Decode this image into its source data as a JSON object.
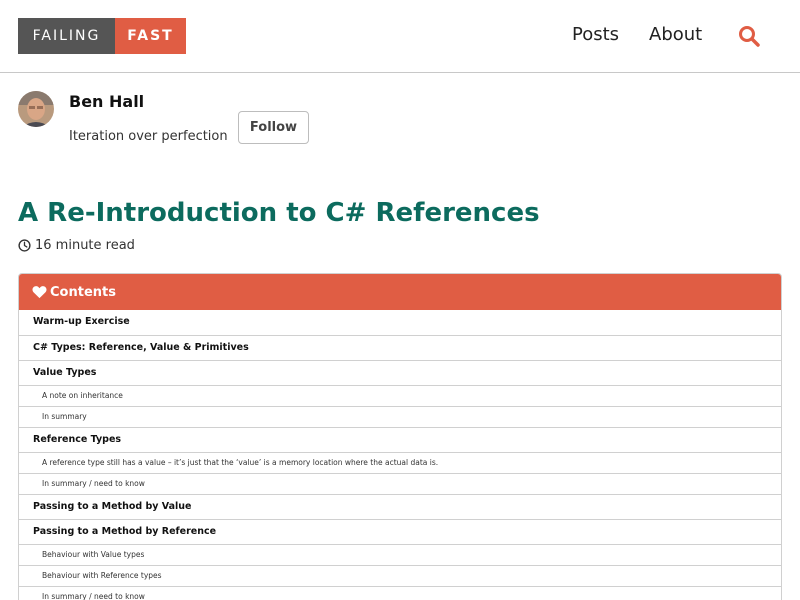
{
  "header": {
    "logo_left": "FAILING",
    "logo_right": "FAST",
    "nav": [
      "Posts",
      "About"
    ],
    "accent": "#e05d44"
  },
  "author": {
    "name": "Ben Hall",
    "bio": "Iteration over perfection",
    "follow_label": "Follow"
  },
  "post": {
    "title": "A Re-Introduction to C# References",
    "read_time": "16 minute read",
    "title_color": "#0c6b5e"
  },
  "toc": {
    "heading": "Contents",
    "items": [
      {
        "label": "Warm-up Exercise",
        "level": 1
      },
      {
        "label": "C# Types: Reference, Value & Primitives",
        "level": 1
      },
      {
        "label": "Value Types",
        "level": 1
      },
      {
        "label": "A note on inheritance",
        "level": 2
      },
      {
        "label": "In summary",
        "level": 2
      },
      {
        "label": "Reference Types",
        "level": 1
      },
      {
        "label": "A reference type still has a value – it’s just that the ‘value’ is a memory location where the actual data is.",
        "level": 2
      },
      {
        "label": "In summary / need to know",
        "level": 2
      },
      {
        "label": "Passing to a Method by Value",
        "level": 1
      },
      {
        "label": "Passing to a Method by Reference",
        "level": 1
      },
      {
        "label": "Behaviour with Value types",
        "level": 2
      },
      {
        "label": "Behaviour with Reference types",
        "level": 2
      },
      {
        "label": "In summary / need to know",
        "level": 2
      }
    ]
  }
}
